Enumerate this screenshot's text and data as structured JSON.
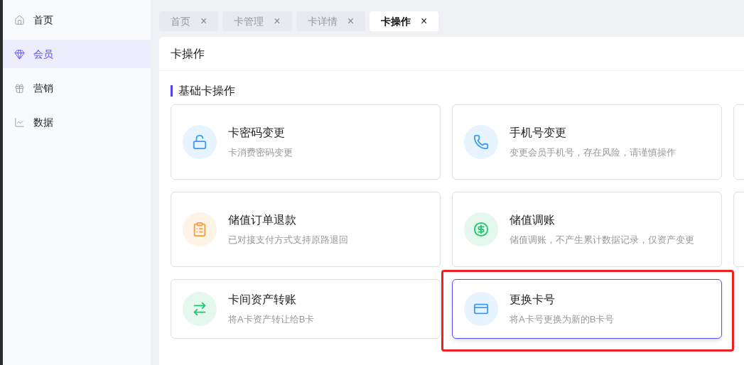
{
  "sidebar": {
    "items": [
      {
        "label": "首页",
        "kind": "home",
        "selected": false
      },
      {
        "label": "会员",
        "kind": "member",
        "selected": true
      },
      {
        "label": "营销",
        "kind": "marketing",
        "selected": false
      },
      {
        "label": "数据",
        "kind": "data",
        "selected": false
      }
    ]
  },
  "tabs": [
    {
      "label": "首页",
      "close": "×",
      "selected": false
    },
    {
      "label": "卡管理",
      "close": "×",
      "selected": false
    },
    {
      "label": "卡详情",
      "close": "×",
      "selected": false
    },
    {
      "label": "卡操作",
      "close": "×",
      "selected": true
    }
  ],
  "panel": {
    "title": "卡操作",
    "section": "基础卡操作",
    "cards": [
      {
        "kind": "lock",
        "color": "#3b9cf5",
        "title": "卡密码变更",
        "description": "卡消费密码变更",
        "selected": false,
        "highlighted": false
      },
      {
        "kind": "phone",
        "color": "#3b9cf5",
        "title": "手机号变更",
        "description": "变更会员手机号，存在风险，请谨慎操作",
        "selected": false,
        "highlighted": false
      },
      {
        "kind": "blank"
      },
      {
        "kind": "clipboard",
        "color": "#f5a03b",
        "title": "储值订单退款",
        "description": "已对接支付方式支持原路退回",
        "selected": false,
        "highlighted": false
      },
      {
        "kind": "exchange",
        "color": "#1ec86a",
        "title": "储值调账",
        "description": "储值调账，不产生累计数据记录，仅资产变更",
        "selected": false,
        "highlighted": false
      },
      {
        "kind": "blank"
      },
      {
        "kind": "transfer",
        "color": "#1ec86a",
        "title": "卡间资产转账",
        "description": "将A卡资产转让给B卡",
        "selected": false,
        "highlighted": false
      },
      {
        "kind": "card",
        "color": "#3b9cf5",
        "title": "更换卡号",
        "description": "将A卡号更换为新的B卡号",
        "selected": true,
        "highlighted": true
      }
    ]
  }
}
